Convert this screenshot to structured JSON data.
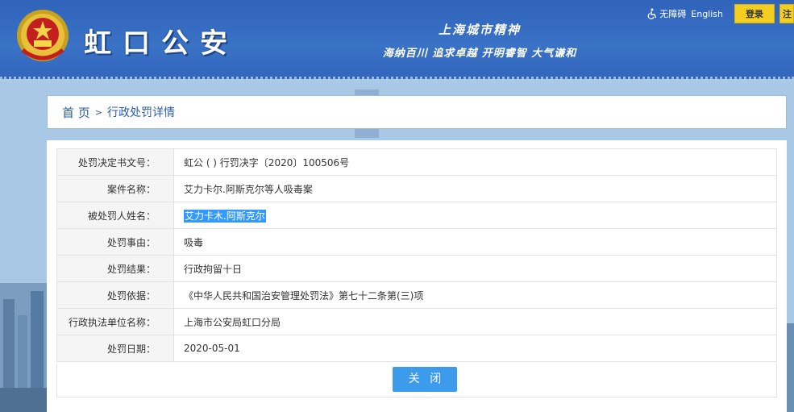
{
  "header": {
    "logo_text": "虹口公安",
    "slogan_line1": "上海城市精神",
    "slogan_line2": "海纳百川 追求卓越 开明睿智 大气谦和",
    "accessibility_label": "无障碍",
    "english_label": "English",
    "login_label": "登录",
    "register_label": "注"
  },
  "breadcrumb": {
    "home": "首 页",
    "separator": ">",
    "current": "行政处罚详情"
  },
  "details": {
    "rows": [
      {
        "label": "处罚决定书文号：",
        "value": "虹公 (  ) 行罚决字〔2020〕100506号"
      },
      {
        "label": "案件名称：",
        "value": "艾力卡尔.阿斯克尔等人吸毒案"
      },
      {
        "label": "被处罚人姓名：",
        "value": "艾力卡木.阿斯克尔"
      },
      {
        "label": "处罚事由：",
        "value": "吸毒"
      },
      {
        "label": "处罚结果：",
        "value": "行政拘留十日"
      },
      {
        "label": "处罚依据：",
        "value": "《中华人民共和国治安管理处罚法》第七十二条第(三)项"
      },
      {
        "label": "行政执法单位名称：",
        "value": "上海市公安局虹口分局"
      },
      {
        "label": "处罚日期：",
        "value": "2020-05-01"
      }
    ]
  },
  "actions": {
    "close_label": "关 闭"
  },
  "colors": {
    "header_blue": "#3267bd",
    "login_yellow": "#f3cd20",
    "close_blue": "#3c9bea",
    "highlight": "#3399ff"
  }
}
